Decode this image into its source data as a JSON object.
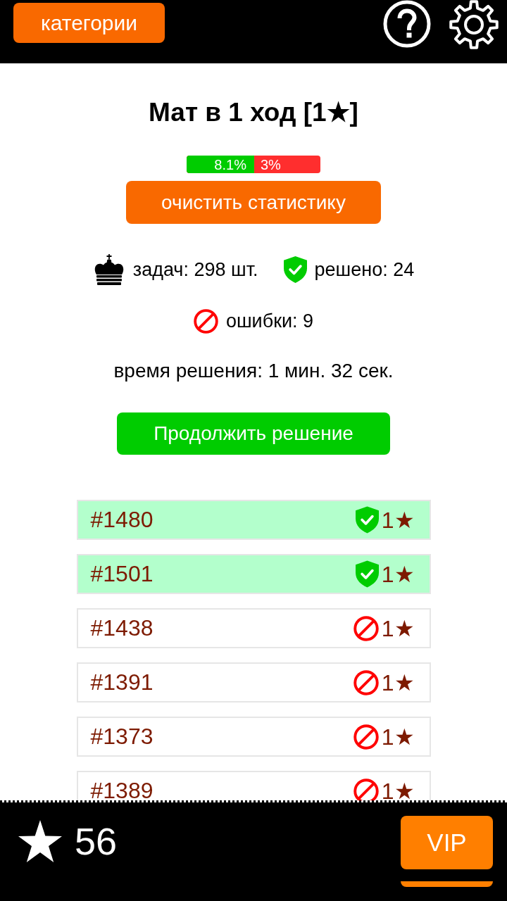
{
  "header": {
    "categories_button": "категории"
  },
  "title": "Мат в 1 ход [1★]",
  "progress": {
    "level": 0.505,
    "solved_label": "8.1%",
    "errors_label": "3%"
  },
  "clear_button": "очистить статистику",
  "stat_rows": [
    {
      "items": [
        {
          "kind": "tasks",
          "text": "задач: 298 шт."
        },
        {
          "kind": "solved",
          "text": "решено: 24"
        }
      ]
    },
    {
      "items": [
        {
          "kind": "errors",
          "text": "ошибки: 9"
        }
      ]
    }
  ],
  "solve_time": "время решения: 1 мин. 32 сек.",
  "continue_button": "Продолжить решение",
  "puzzles": [
    {
      "number": "#1480",
      "solved": true,
      "rating": "1★"
    },
    {
      "number": "#1501",
      "solved": true,
      "rating": "1★"
    },
    {
      "number": "#1438",
      "solved": false,
      "rating": "1★"
    },
    {
      "number": "#1391",
      "solved": false,
      "rating": "1★"
    },
    {
      "number": "#1373",
      "solved": false,
      "rating": "1★"
    },
    {
      "number": "#1389",
      "solved": false,
      "rating": "1★"
    }
  ],
  "footer": {
    "stars": "56",
    "vip_button": "VIP"
  }
}
